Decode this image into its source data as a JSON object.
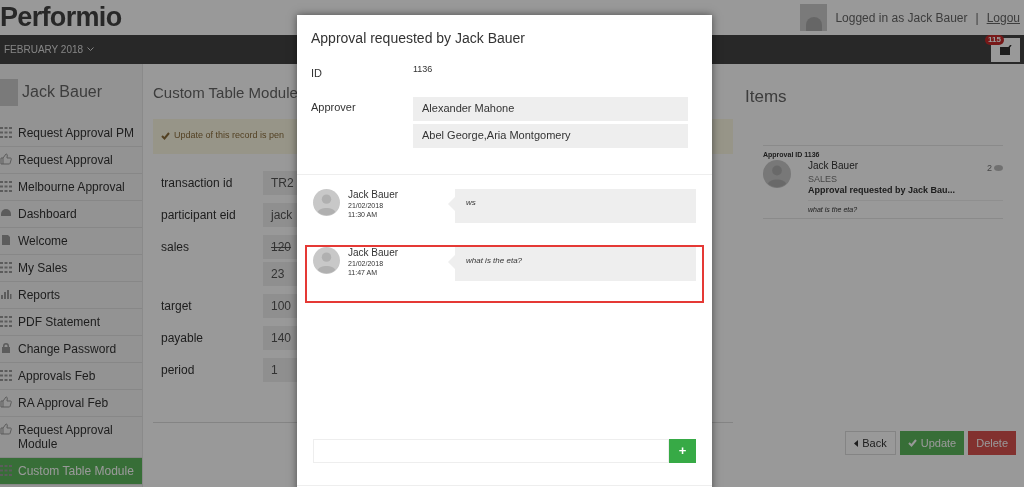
{
  "header": {
    "logo": "Performio",
    "logged_in": "Logged in as Jack Bauer",
    "separator": "|",
    "logout": "Logou"
  },
  "nav": {
    "period": "FEBRUARY 2018",
    "badge": "115"
  },
  "sidebar": {
    "user": "Jack Bauer",
    "items": [
      {
        "label": "Request Approval PM",
        "kind": "grid",
        "selected": false
      },
      {
        "label": "Request Approval",
        "kind": "thumb",
        "selected": false
      },
      {
        "label": "Melbourne Approval",
        "kind": "grid",
        "selected": false
      },
      {
        "label": "Dashboard",
        "kind": "dashboard",
        "selected": false
      },
      {
        "label": "Welcome",
        "kind": "file",
        "selected": false
      },
      {
        "label": "My Sales",
        "kind": "grid",
        "selected": false
      },
      {
        "label": "Reports",
        "kind": "chart",
        "selected": false
      },
      {
        "label": "PDF Statement",
        "kind": "grid",
        "selected": false
      },
      {
        "label": "Change Password",
        "kind": "lock",
        "selected": false
      },
      {
        "label": "Approvals Feb",
        "kind": "grid",
        "selected": false
      },
      {
        "label": "RA Approval Feb",
        "kind": "thumb",
        "selected": false
      },
      {
        "label": "Request Approval Module",
        "kind": "thumb",
        "selected": false
      },
      {
        "label": "Custom Table Module",
        "kind": "grid",
        "selected": true
      }
    ]
  },
  "main": {
    "title": "Custom Table Module",
    "alert": "Update of this record is pen",
    "fields": [
      {
        "label": "transaction id",
        "values": [
          {
            "text": "TR2",
            "struck": false
          }
        ]
      },
      {
        "label": "participant eid",
        "values": [
          {
            "text": "jack",
            "struck": false
          }
        ]
      },
      {
        "label": "sales",
        "values": [
          {
            "text": "120",
            "struck": true
          },
          {
            "text": "23",
            "struck": false
          }
        ]
      },
      {
        "label": "target",
        "values": [
          {
            "text": "100",
            "struck": false
          }
        ]
      },
      {
        "label": "payable",
        "values": [
          {
            "text": "140",
            "struck": false
          }
        ]
      },
      {
        "label": "period",
        "values": [
          {
            "text": "1",
            "struck": false
          }
        ]
      }
    ],
    "buttons": [
      {
        "label": "Back",
        "kind": "back"
      },
      {
        "label": "Update",
        "kind": "update"
      },
      {
        "label": "Delete",
        "kind": "delete"
      }
    ]
  },
  "items": {
    "title": "Items",
    "card": {
      "heading": "Approval ID 1136",
      "name": "Jack Bauer",
      "role": "SALES",
      "subject": "Approval requested by Jack Bau...",
      "comments": "2",
      "last_message": "what is the eta?"
    }
  },
  "modal": {
    "title": "Approval requested by Jack Bauer",
    "id_label": "ID",
    "id_value": "1136",
    "approver_label": "Approver",
    "approvers": [
      "Alexander Mahone",
      "Abel George,Aria Montgomery"
    ],
    "messages": [
      {
        "author": "Jack Bauer",
        "date": "21/02/2018",
        "time": "11:30 AM",
        "text": "ws",
        "highlighted": false
      },
      {
        "author": "Jack Bauer",
        "date": "21/02/2018",
        "time": "11:47 AM",
        "text": "what is the eta?",
        "highlighted": true
      }
    ],
    "add_button": "+"
  }
}
